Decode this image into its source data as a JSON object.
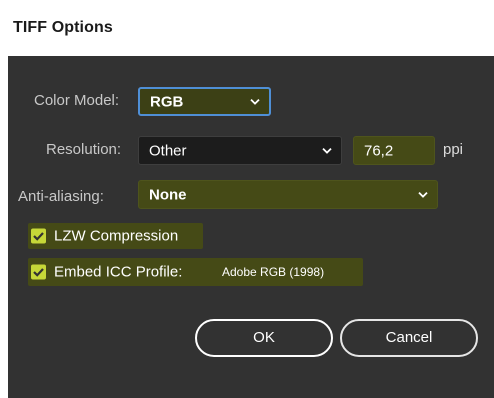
{
  "dialog": {
    "title": "TIFF Options"
  },
  "color_model": {
    "label": "Color Model:",
    "value": "RGB"
  },
  "resolution": {
    "label": "Resolution:",
    "value": "Other",
    "custom_value": "76,2",
    "unit": "ppi"
  },
  "anti_aliasing": {
    "label": "Anti-aliasing:",
    "value": "None"
  },
  "lzw_compression": {
    "label": "LZW Compression",
    "checked": true
  },
  "embed_icc": {
    "label": "Embed ICC Profile:",
    "checked": true,
    "profile": "Adobe RGB (1998)"
  },
  "buttons": {
    "ok": "OK",
    "cancel": "Cancel"
  },
  "icons": {
    "dropdown": "chevron-down-icon",
    "checkbox": "checkmark-icon"
  },
  "colors": {
    "panel_bg": "#323232",
    "highlight": "#454a16",
    "focus_ring": "#4f8fd6",
    "checkbox": "#c6d838"
  }
}
